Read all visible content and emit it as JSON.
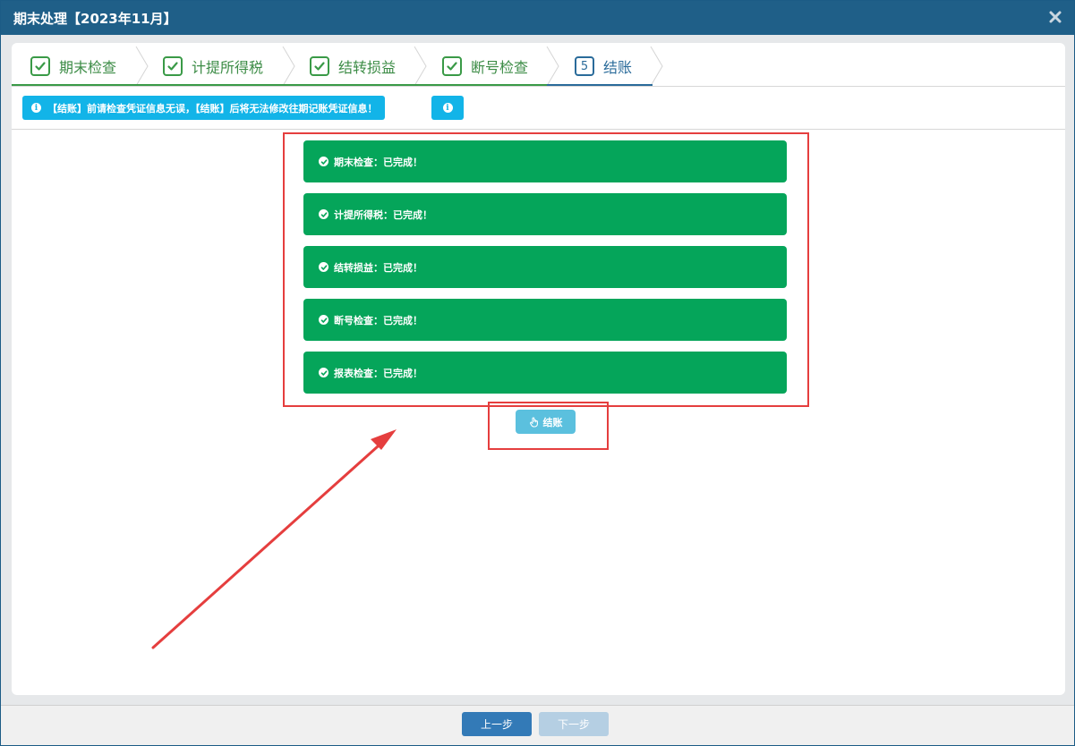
{
  "dialog": {
    "title": "期末处理【2023年11月】",
    "close_icon": "close-icon"
  },
  "steps": [
    {
      "label": "期末检查",
      "state": "done",
      "icon": "check-icon"
    },
    {
      "label": "计提所得税",
      "state": "done",
      "icon": "check-icon"
    },
    {
      "label": "结转损益",
      "state": "done",
      "icon": "check-icon"
    },
    {
      "label": "断号检查",
      "state": "done",
      "icon": "check-icon"
    },
    {
      "label": "结账",
      "state": "active",
      "number": "5"
    }
  ],
  "info": {
    "notice": "【结账】前请检查凭证信息无误，【结账】后将无法修改往期记账凭证信息！",
    "icon": "info-icon"
  },
  "status_items": [
    {
      "text": "期末检查：已完成！"
    },
    {
      "text": "计提所得税：已完成！"
    },
    {
      "text": "结转损益：已完成！"
    },
    {
      "text": "断号检查：已完成！"
    },
    {
      "text": "报表检查：已完成！"
    }
  ],
  "settle_button": {
    "label": "结账",
    "icon": "hand-pointer-icon"
  },
  "footer": {
    "prev_label": "上一步",
    "next_label": "下一步"
  },
  "colors": {
    "titlebar": "#1f5f88",
    "success": "#05a55a",
    "info": "#12b4e8",
    "annotation": "#e53e3e"
  }
}
